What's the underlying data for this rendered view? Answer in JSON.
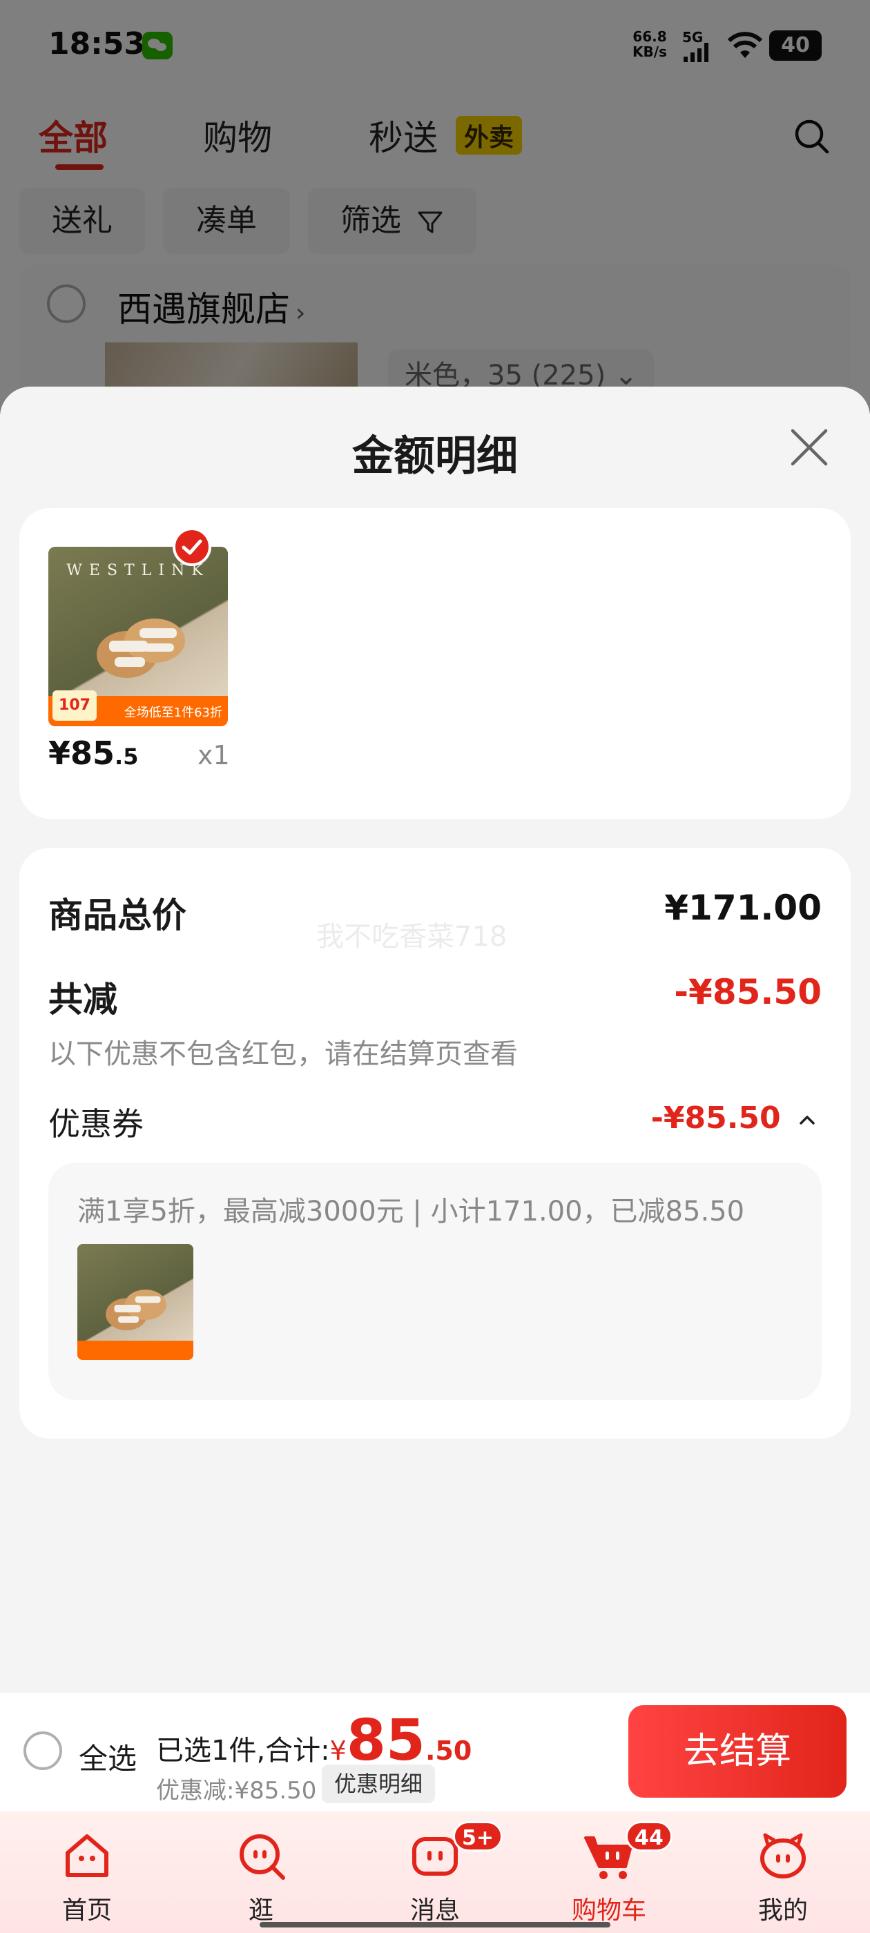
{
  "status_bar": {
    "time": "18:53",
    "net_speed_value": "66.8",
    "net_speed_unit": "KB/s",
    "network": "5G",
    "battery": "40"
  },
  "top_tabs": [
    {
      "label": "全部",
      "active": true
    },
    {
      "label": "购物",
      "active": false
    },
    {
      "label": "秒送",
      "active": false,
      "badge": "外卖"
    }
  ],
  "filter_chips": [
    "送礼",
    "凑单",
    "筛选"
  ],
  "shop": {
    "name": "西遇旗舰店",
    "sku": "米色，35 (225)"
  },
  "sheet": {
    "title": "金额明细",
    "product": {
      "brand": "WESTLINK",
      "price_main": "¥85",
      "price_decimal": ".5",
      "quantity": "x1",
      "tag_price": "107",
      "banner_text": "全场低至1件63折"
    },
    "summary": {
      "total_label": "商品总价",
      "total_value": "¥171.00",
      "reduce_label": "共减",
      "reduce_value": "-¥85.50",
      "hint": "以下优惠不包含红包，请在结算页查看",
      "watermark": "我不吃香菜718",
      "coupon_label": "优惠券",
      "coupon_value": "-¥85.50",
      "coupon_desc": "满1享5折，最高减3000元 | 小计171.00，已减85.50"
    }
  },
  "checkout": {
    "select_all": "全选",
    "selected_prefix": "已选1件,合计:",
    "currency": "¥",
    "total_int": "85",
    "total_dec": ".50",
    "discount": "优惠减:¥85.50",
    "detail_button": "优惠明细",
    "checkout_button": "去结算"
  },
  "tabbar": [
    {
      "label": "首页",
      "icon": "home-icon",
      "active": false
    },
    {
      "label": "逛",
      "icon": "browse-icon",
      "active": false
    },
    {
      "label": "消息",
      "icon": "message-icon",
      "active": false,
      "badge": "5+"
    },
    {
      "label": "购物车",
      "icon": "cart-icon",
      "active": true,
      "badge": "44"
    },
    {
      "label": "我的",
      "icon": "profile-icon",
      "active": false
    }
  ],
  "colors": {
    "accent": "#e1251b",
    "waimai_badge": "#f7d300",
    "sheet_bg": "#f4f4f5"
  }
}
